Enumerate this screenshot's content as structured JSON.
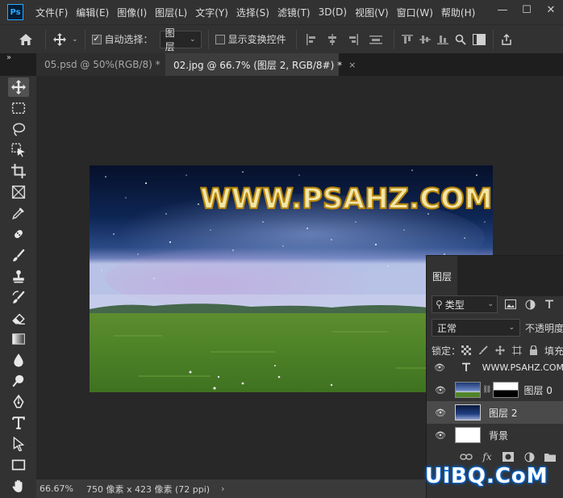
{
  "app": {
    "logo_text": "Ps"
  },
  "menu": [
    "文件(F)",
    "编辑(E)",
    "图像(I)",
    "图层(L)",
    "文字(Y)",
    "选择(S)",
    "滤镜(T)",
    "3D(D)",
    "视图(V)",
    "窗口(W)",
    "帮助(H)"
  ],
  "window_controls": {
    "minimize": "—",
    "restore": "☐",
    "close": "✕"
  },
  "options": {
    "auto_select_label": "自动选择：",
    "auto_select_checked": true,
    "auto_select_target": "图层",
    "show_transform_label": "显示变换控件",
    "show_transform_checked": false
  },
  "tabs": [
    {
      "label": "05.psd @ 50%(RGB/8) *",
      "close": "×",
      "active": false
    },
    {
      "label": "02.jpg @ 66.7% (图层 2, RGB/8#) *",
      "close": "×",
      "active": true
    }
  ],
  "collapse_glyph": "»",
  "canvas": {
    "watermark": "WWW.PSAHZ.COM"
  },
  "status": {
    "zoom": "66.67%",
    "doc_info": "750 像素 x 423 像素 (72 ppi)",
    "arrow": "›"
  },
  "layers_panel": {
    "tab_label": "图层",
    "filter_label": "类型",
    "blend_mode": "正常",
    "opacity_label": "不透明度",
    "lock_label": "锁定：",
    "fill_label": "填充",
    "layers": [
      {
        "name": "WWW.PSAHZ.COM",
        "kind": "text",
        "visible": true,
        "selected": false
      },
      {
        "name": "图层 0",
        "kind": "masked",
        "visible": true,
        "selected": false
      },
      {
        "name": "图层 2",
        "kind": "image",
        "visible": true,
        "selected": true
      },
      {
        "name": "背景",
        "kind": "background",
        "visible": true,
        "selected": false
      }
    ]
  },
  "site_logo": "UiBQ.CoM",
  "colors": {
    "accent": "#31a8ff",
    "selected_row": "#4a4a4a",
    "logo_glow": "#0b63c9"
  }
}
